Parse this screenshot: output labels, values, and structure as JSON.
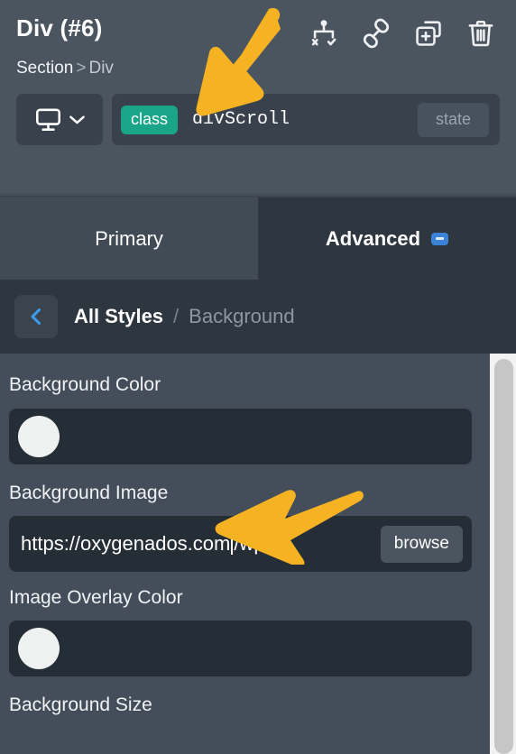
{
  "header": {
    "element_title": "Div (#6)",
    "breadcrumb": {
      "parent": "Section",
      "separator": ">",
      "current": "Div"
    },
    "icons": [
      {
        "name": "structure-icon",
        "label": "Structure"
      },
      {
        "name": "link-icon",
        "label": "Link"
      },
      {
        "name": "duplicate-icon",
        "label": "Duplicate"
      },
      {
        "name": "trash-icon",
        "label": "Delete"
      }
    ],
    "device_selector": {
      "icon": "monitor-icon",
      "chevron": "chevron-down-icon"
    },
    "class_row": {
      "pill_label": "class",
      "class_value": "divScroll",
      "state_label": "state"
    }
  },
  "tabs": [
    {
      "label": "Primary",
      "active": false,
      "badge": null
    },
    {
      "label": "Advanced",
      "active": true,
      "badge": "minus"
    }
  ],
  "breadcrumb_bar": {
    "back_icon": "chevron-left-icon",
    "root": "All Styles",
    "slash": "/",
    "leaf": "Background"
  },
  "fields": [
    {
      "type": "color",
      "label": "Background Color",
      "swatch_color": "#eff0f0"
    },
    {
      "type": "url",
      "label": "Background Image",
      "value_before_caret": "https://oxygenados.com",
      "value_after_caret": "/wp-",
      "button_label": "browse"
    },
    {
      "type": "color",
      "label": "Image Overlay Color",
      "swatch_color": "#eff0f0"
    },
    {
      "type": "label_only",
      "label": "Background Size"
    }
  ],
  "scrollbar": {
    "track_color": "#f2f2f2",
    "thumb_color": "#c6c6c6"
  },
  "annotations": {
    "arrow_color": "#f5b323",
    "arrows": [
      {
        "name": "arrow-pointing-to-class-field",
        "direction": "down-left"
      },
      {
        "name": "arrow-pointing-to-background-image-field",
        "direction": "left"
      }
    ]
  },
  "theme": {
    "header_bg": "#4a5560",
    "tab_active_bg": "#2e3640",
    "tab_inactive_bg": "#414b56",
    "crumb_bar_bg": "#2e3640",
    "content_bg": "#434e5a",
    "input_bg": "#252d36",
    "accent_green": "#1aa589",
    "accent_blue": "#3b82d9"
  }
}
